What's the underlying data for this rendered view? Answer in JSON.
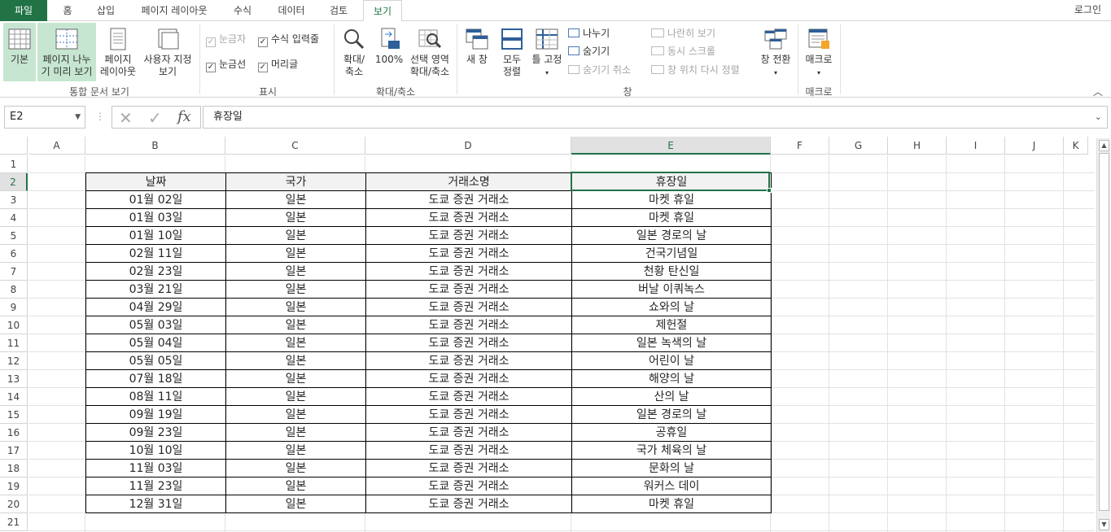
{
  "tabs": {
    "file": "파일",
    "home": "홈",
    "insert": "삽입",
    "page_layout": "페이지 레이아웃",
    "formulas": "수식",
    "data": "데이터",
    "review": "검토",
    "view": "보기"
  },
  "login": "로그인",
  "ribbon": {
    "workbook_views": {
      "normal": "기본",
      "page_break_1": "페이지 나누",
      "page_break_2": "기 미리 보기",
      "page_layout_1": "페이지",
      "page_layout_2": "레이아웃",
      "custom_1": "사용자 지정",
      "custom_2": "보기",
      "group_label": "통합 문서 보기"
    },
    "show": {
      "ruler": "눈금자",
      "formula_bar": "수식 입력줄",
      "gridlines": "눈금선",
      "headings": "머리글",
      "group_label": "표시"
    },
    "zoom": {
      "zoom_1": "확대/",
      "zoom_2": "축소",
      "zoom100": "100%",
      "zoom_sel_1": "선택 영역",
      "zoom_sel_2": "확대/축소",
      "group_label": "확대/축소"
    },
    "window": {
      "new_window": "새 창",
      "arrange_1": "모두",
      "arrange_2": "정렬",
      "freeze": "틀 고정",
      "split": "나누기",
      "hide": "숨기기",
      "unhide": "숨기기 취소",
      "side_by_side": "나란히 보기",
      "sync_scroll": "동시 스크롤",
      "reset_pos": "창 위치 다시 정렬",
      "switch": "창 전환",
      "group_label": "창"
    },
    "macros": {
      "macros": "매크로",
      "group_label": "매크로"
    }
  },
  "formula_bar": {
    "name_box": "E2",
    "content": "휴장일",
    "fx": "fx"
  },
  "columns": [
    "A",
    "B",
    "C",
    "D",
    "E",
    "F",
    "G",
    "H",
    "I",
    "J",
    "K"
  ],
  "rows": [
    "1",
    "2",
    "3",
    "4",
    "5",
    "6",
    "7",
    "8",
    "9",
    "10",
    "11",
    "12",
    "13",
    "14",
    "15",
    "16",
    "17",
    "18",
    "19",
    "20",
    "21"
  ],
  "table": {
    "headers": [
      "날짜",
      "국가",
      "거래소명",
      "휴장일"
    ],
    "rows": [
      [
        "01월 02일",
        "일본",
        "도쿄 증권 거래소",
        "마켓 휴일"
      ],
      [
        "01월 03일",
        "일본",
        "도쿄 증권 거래소",
        "마켓 휴일"
      ],
      [
        "01월 10일",
        "일본",
        "도쿄 증권 거래소",
        "일본 경로의 날"
      ],
      [
        "02월 11일",
        "일본",
        "도쿄 증권 거래소",
        "건국기념일"
      ],
      [
        "02월 23일",
        "일본",
        "도쿄 증권 거래소",
        "천황 탄신일"
      ],
      [
        "03월 21일",
        "일본",
        "도쿄 증권 거래소",
        "버날 이쿼녹스"
      ],
      [
        "04월 29일",
        "일본",
        "도쿄 증권 거래소",
        "쇼와의 날"
      ],
      [
        "05월 03일",
        "일본",
        "도쿄 증권 거래소",
        "제헌절"
      ],
      [
        "05월 04일",
        "일본",
        "도쿄 증권 거래소",
        "일본 녹색의 날"
      ],
      [
        "05월 05일",
        "일본",
        "도쿄 증권 거래소",
        "어린이 날"
      ],
      [
        "07월 18일",
        "일본",
        "도쿄 증권 거래소",
        "해양의 날"
      ],
      [
        "08월 11일",
        "일본",
        "도쿄 증권 거래소",
        "산의 날"
      ],
      [
        "09월 19일",
        "일본",
        "도쿄 증권 거래소",
        "일본 경로의 날"
      ],
      [
        "09월 23일",
        "일본",
        "도쿄 증권 거래소",
        "공휴일"
      ],
      [
        "10월 10일",
        "일본",
        "도쿄 증권 거래소",
        "국가 체육의 날"
      ],
      [
        "11월 03일",
        "일본",
        "도쿄 증권 거래소",
        "문화의 날"
      ],
      [
        "11월 23일",
        "일본",
        "도쿄 증권 거래소",
        "워커스 데이"
      ],
      [
        "12월 31일",
        "일본",
        "도쿄 증권 거래소",
        "마켓 휴일"
      ]
    ]
  },
  "selected_cell": "E2",
  "colors": {
    "accent": "#217346",
    "selected_view": "#c6e6d1"
  }
}
